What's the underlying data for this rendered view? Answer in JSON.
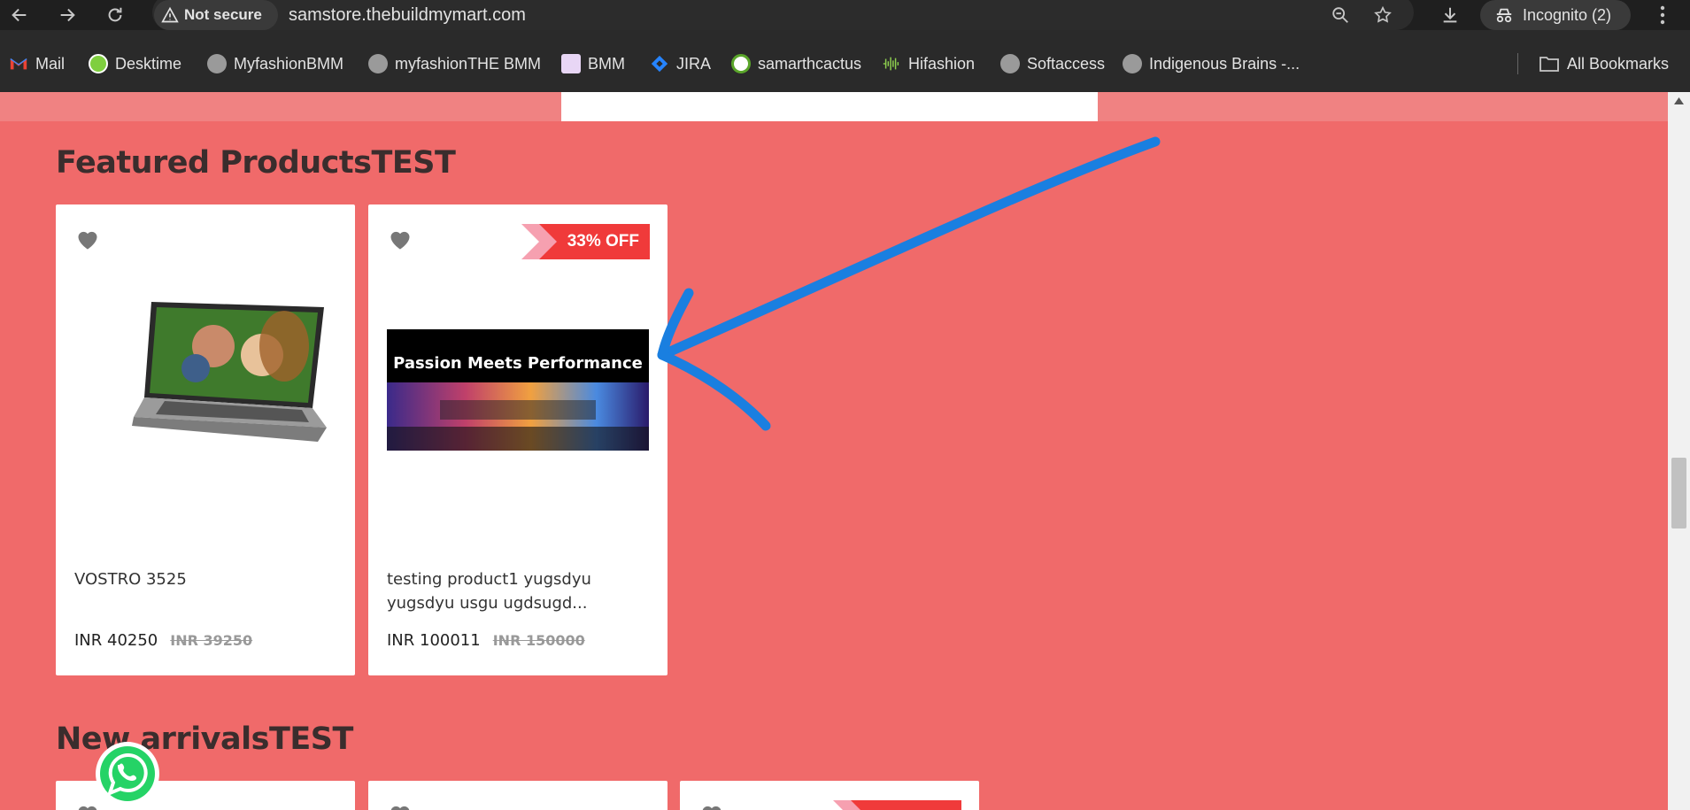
{
  "browser": {
    "not_secure_label": "Not secure",
    "url": "samstore.thebuildmymart.com",
    "incognito_label": "Incognito (2)"
  },
  "bookmarks": [
    {
      "label": "Mail",
      "icon": "gmail-icon"
    },
    {
      "label": "Desktime",
      "icon": "desktime-icon"
    },
    {
      "label": "MyfashionBMM",
      "icon": "globe-icon"
    },
    {
      "label": "myfashionTHE BMM",
      "icon": "globe-icon"
    },
    {
      "label": "BMM",
      "icon": "bmm-icon"
    },
    {
      "label": "JIRA",
      "icon": "jira-icon"
    },
    {
      "label": "samarthcactus",
      "icon": "samarth-icon"
    },
    {
      "label": "Hifashion",
      "icon": "hifashion-icon"
    },
    {
      "label": "Softaccess",
      "icon": "globe-icon"
    },
    {
      "label": "Indigenous Brains -...",
      "icon": "globe-icon"
    }
  ],
  "all_bookmarks_label": "All Bookmarks",
  "featured": {
    "title": "Featured ProductsTEST",
    "products": [
      {
        "name": "VOSTRO 3525",
        "price": "INR 40250",
        "old_price": "INR 39250",
        "badge": ""
      },
      {
        "name": "testing product1 yugsdyu yugsdyu usgu ugdsugd...",
        "price": "INR 100011",
        "old_price": "INR 150000",
        "badge": "33% OFF",
        "image_text": "Passion Meets Performance"
      }
    ]
  },
  "new_arrivals": {
    "title": "New arrivalsTEST"
  },
  "colors": {
    "page_bg": "#f06a6a",
    "badge_red": "#f03a3a",
    "badge_pink": "#f6a0b0",
    "annotation_blue": "#1a7fe0"
  }
}
